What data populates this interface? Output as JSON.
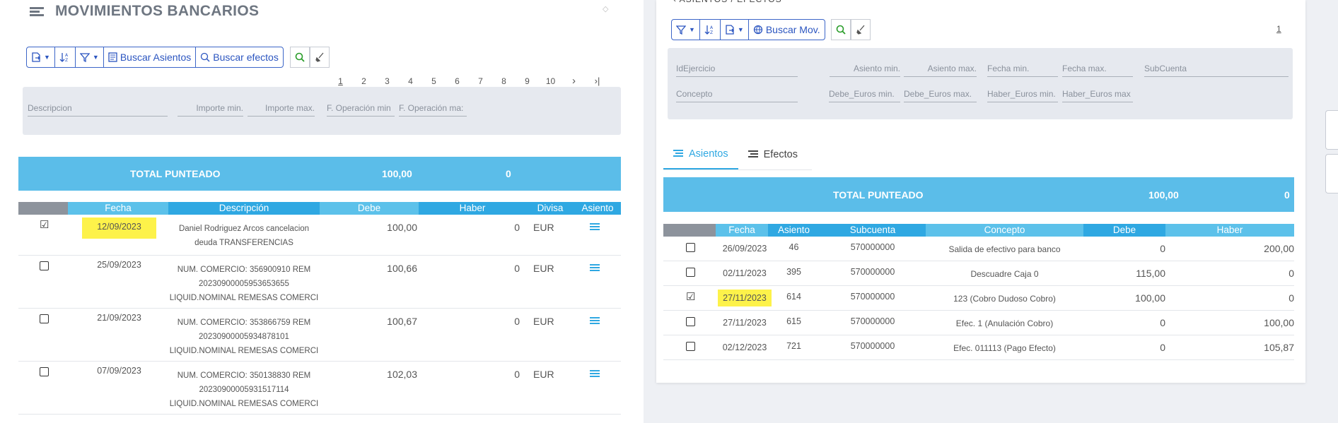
{
  "left": {
    "title": "MOVIMIENTOS BANCARIOS",
    "toolbar": {
      "buscar_asientos": "Buscar Asientos",
      "buscar_efectos": "Buscar efectos"
    },
    "pager": [
      "1",
      "2",
      "3",
      "4",
      "5",
      "6",
      "7",
      "8",
      "9",
      "10",
      ">",
      ">|"
    ],
    "filters": {
      "descripcion": "Descripcion",
      "importe_min": "Importe min.",
      "importe_max": "Importe max.",
      "f_operacion_min": "F. Operación min",
      "f_operacion_max": "F. Operación ma:"
    },
    "total": {
      "label": "TOTAL PUNTEADO",
      "amount": "100,00",
      "count": "0"
    },
    "columns": [
      "",
      "Fecha",
      "Descripción",
      "Debe",
      "Haber",
      "Divisa",
      "Asiento"
    ],
    "rows": [
      {
        "checked": true,
        "fecha": "12/09/2023",
        "highlight": true,
        "desc1": "Daniel Rodriguez Arcos cancelacion",
        "desc2": "deuda TRANSFERENCIAS",
        "desc3": "",
        "debe": "100,00",
        "haber": "0",
        "divisa": "EUR"
      },
      {
        "checked": false,
        "fecha": "25/09/2023",
        "highlight": false,
        "desc1": "NUM. COMERCIO: 356900910 REM",
        "desc2": "20230900005953653655",
        "desc3": "LIQUID.NOMINAL REMESAS COMERCI",
        "debe": "100,66",
        "haber": "0",
        "divisa": "EUR"
      },
      {
        "checked": false,
        "fecha": "21/09/2023",
        "highlight": false,
        "desc1": "NUM. COMERCIO: 353866759 REM",
        "desc2": "20230900005934878101",
        "desc3": "LIQUID.NOMINAL REMESAS COMERCI",
        "debe": "100,67",
        "haber": "0",
        "divisa": "EUR"
      },
      {
        "checked": false,
        "fecha": "07/09/2023",
        "highlight": false,
        "desc1": "NUM. COMERCIO: 350138830 REM",
        "desc2": "20230900005931517114",
        "desc3": "LIQUID.NOMINAL REMESAS COMERCI",
        "debe": "102,03",
        "haber": "0",
        "divisa": "EUR"
      }
    ]
  },
  "right": {
    "toolbar": {
      "buscar_mov": "Buscar Mov."
    },
    "page": "1",
    "filters": {
      "id_ejercicio": "IdEjercicio",
      "asiento_min": "Asiento min.",
      "asiento_max": "Asiento max.",
      "fecha_min": "Fecha min.",
      "fecha_max": "Fecha max.",
      "subcuenta": "SubCuenta",
      "concepto": "Concepto",
      "debe_min": "Debe_Euros min.",
      "debe_max": "Debe_Euros max.",
      "haber_min": "Haber_Euros min.",
      "haber_max": "Haber_Euros max"
    },
    "tabs": [
      "Asientos",
      "Efectos"
    ],
    "total": {
      "label": "TOTAL PUNTEADO",
      "amount": "100,00",
      "count": "0"
    },
    "columns": [
      "",
      "Fecha",
      "Asiento",
      "Subcuenta",
      "Concepto",
      "Debe",
      "Haber"
    ],
    "rows": [
      {
        "checked": false,
        "fecha": "26/09/2023",
        "highlight": false,
        "asiento": "46",
        "subcuenta": "570000000",
        "concepto": "Salida de efectivo para banco",
        "debe": "0",
        "haber": "200,00"
      },
      {
        "checked": false,
        "fecha": "02/11/2023",
        "highlight": false,
        "asiento": "395",
        "subcuenta": "570000000",
        "concepto": "Descuadre Caja 0",
        "debe": "115,00",
        "haber": "0"
      },
      {
        "checked": true,
        "fecha": "27/11/2023",
        "highlight": true,
        "asiento": "614",
        "subcuenta": "570000000",
        "concepto": "123 (Cobro Dudoso Cobro)",
        "debe": "100,00",
        "haber": "0"
      },
      {
        "checked": false,
        "fecha": "27/11/2023",
        "highlight": false,
        "asiento": "615",
        "subcuenta": "570000000",
        "concepto": "Efec. 1 (Anulación Cobro)",
        "debe": "0",
        "haber": "100,00"
      },
      {
        "checked": false,
        "fecha": "02/12/2023",
        "highlight": false,
        "asiento": "721",
        "subcuenta": "570000000",
        "concepto": "Efec. 011113 (Pago Efecto)",
        "debe": "0",
        "haber": "105,87"
      }
    ]
  },
  "colors": {
    "accent": "#2fa8e2",
    "total_bar": "#5bbde9",
    "highlight": "#fdf24a",
    "toolbar_blue": "#2b55c0"
  }
}
